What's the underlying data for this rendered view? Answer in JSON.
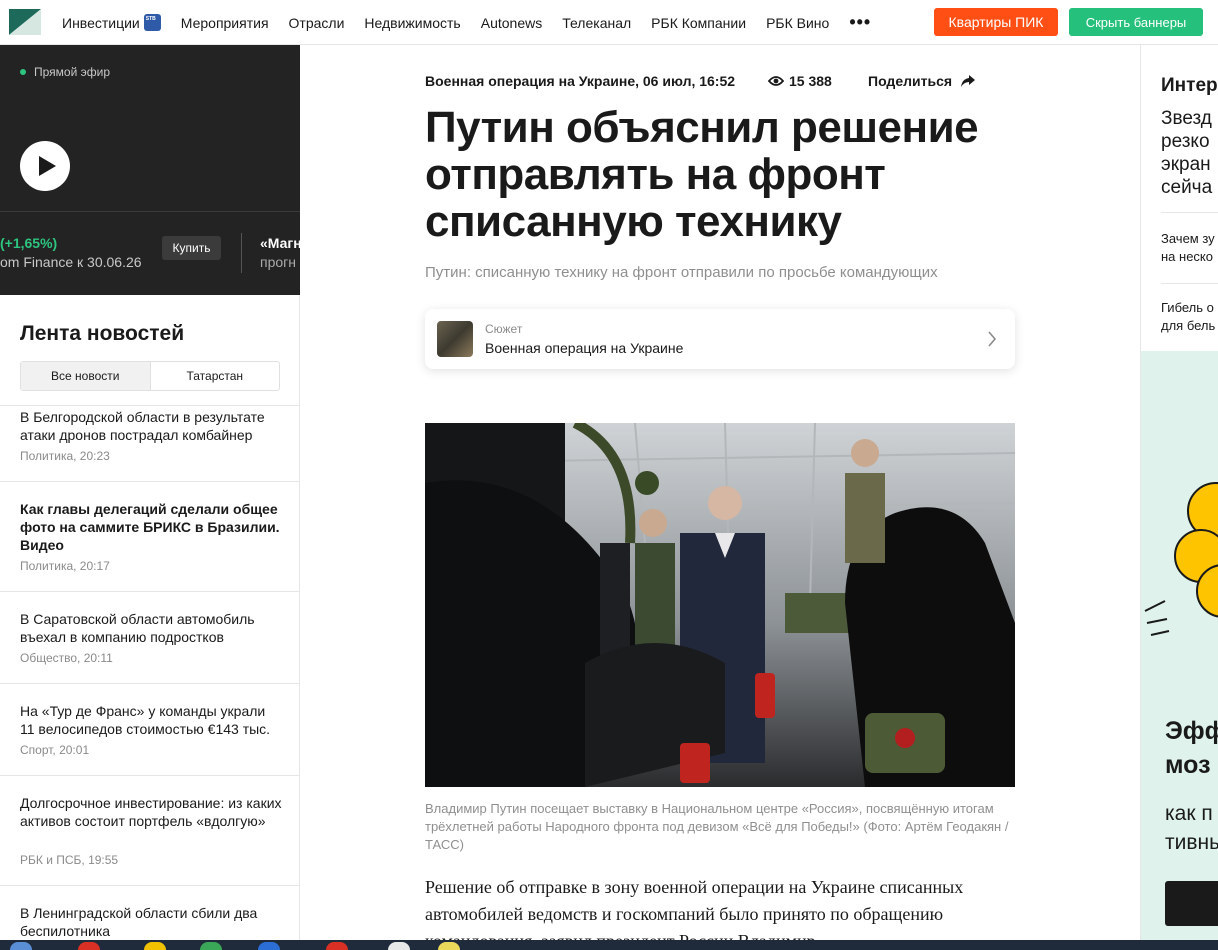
{
  "topnav": {
    "items": [
      "Инвестиции",
      "Мероприятия",
      "Отрасли",
      "Недвижимость",
      "Autonews",
      "Телеканал",
      "РБК Компании",
      "РБК Вино"
    ],
    "more": "•••",
    "cta_pik": "Квартиры ПИК",
    "cta_hide": "Скрыть баннеры"
  },
  "live": {
    "label": "Прямой эфир",
    "change": "(+1,65%)",
    "source": "om Finance к 30.06.26",
    "buy": "Купить",
    "next_title": "«Магн",
    "next_sub": "прогн"
  },
  "feed": {
    "title": "Лента новостей",
    "tabs": [
      "Все новости",
      "Татарстан"
    ],
    "items": [
      {
        "title": "В Белгородской области в результате атаки дронов пострадал комбайнер",
        "meta": "Политика, 20:23",
        "bold": false
      },
      {
        "title": "Как главы делегаций сделали общее фото на саммите БРИКС в Бразилии. Видео",
        "meta": "Политика, 20:17",
        "bold": true
      },
      {
        "title": "В Саратовской области автомобиль въехал в компанию подростков",
        "meta": "Общество, 20:11",
        "bold": false
      },
      {
        "title": "На «Тур де Франс» у команды украли 11 велосипедов стоимостью €143 тыс.",
        "meta": "Спорт, 20:01",
        "bold": false
      },
      {
        "title": "Долгосрочное инвестирование: из каких активов состоит портфель «вдолгую»",
        "meta": "РБК и ПСБ, 19:55",
        "bold": false
      },
      {
        "title": "В Ленинградской области сбили два беспилотника",
        "meta": "",
        "bold": false
      }
    ]
  },
  "article": {
    "meta": "Военная операция на Украине, 06 июл, 16:52",
    "views": "15 388",
    "share": "Поделиться",
    "headline": "Путин объяснил решение отправлять на фронт списанную технику",
    "subhead": "Путин: списанную технику на фронт отправили по просьбе командующих",
    "story_kind": "Сюжет",
    "story_name": "Военная операция на Украине",
    "caption": "Владимир Путин посещает выставку в Национальном центре «Россия», посвящённую итогам трёхлетней работы Народного фронта под девизом «Всё для Победы!» (Фото: Артём Геодакян / ТАСС)",
    "lead": "Решение об отправке в зону военной операции на Украине списанных автомобилей ведомств и госкомпаний было принято по обращению командования, заявил президент России Владимир"
  },
  "right": {
    "title": "Интер",
    "big": [
      "Звезд",
      "резко",
      "экран",
      "сейча"
    ],
    "small1": [
      "Зачем зу",
      "на неско"
    ],
    "small2": [
      "Гибель о",
      "для бель"
    ],
    "ad_title": [
      "Эфф",
      "моз"
    ],
    "ad_sub": [
      "как п",
      "тивны"
    ]
  },
  "colors": {
    "accent_green": "#2dc57f",
    "pik": "#ff4f14",
    "hide": "#25c07b"
  }
}
